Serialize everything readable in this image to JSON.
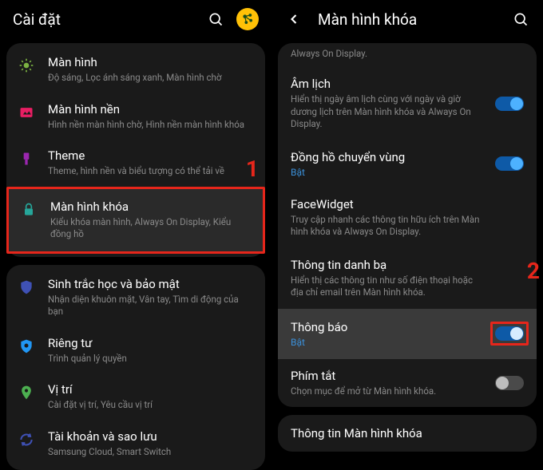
{
  "left": {
    "header_title": "Cài đặt",
    "items": [
      {
        "title": "Màn hình",
        "sub": "Độ sáng, Lọc ánh sáng xanh, Màn hình chờ"
      },
      {
        "title": "Màn hình nền",
        "sub": "Hình nền màn hình chờ, Hình nền màn hình khóa"
      },
      {
        "title": "Theme",
        "sub": "Theme, hình nền và biểu tượng có thể tải về"
      },
      {
        "title": "Màn hình khóa",
        "sub": "Kiểu khóa màn hình, Always On Display, Kiểu đồng hồ"
      },
      {
        "title": "Sinh trắc học và bảo mật",
        "sub": "Nhận diện khuôn mặt, Vân tay, Tìm di động của bạn"
      },
      {
        "title": "Riêng tư",
        "sub": "Trình quản lý quyền"
      },
      {
        "title": "Vị trí",
        "sub": "Cài đặt vị trí, Yêu cầu vị trí"
      },
      {
        "title": "Tài khoản và sao lưu",
        "sub": "Samsung Cloud, Smart Switch"
      }
    ],
    "badge1": "1"
  },
  "right": {
    "header_title": "Màn hình khóa",
    "truncated": "Always On Display.",
    "rows": {
      "amlich": {
        "title": "Âm lịch",
        "sub": "Hiển thị ngày âm lịch cùng với ngày và giờ dương lịch trên Màn hình khóa và Always On Display."
      },
      "dongho": {
        "title": "Đồng hồ chuyển vùng",
        "status": "Bật"
      },
      "facewidget": {
        "title": "FaceWidget",
        "sub": "Truy cập nhanh các thông tin hữu ích trên Màn hình khóa và Always On Display."
      },
      "danhba": {
        "title": "Thông tin danh bạ",
        "sub": "Hiển thị các thông tin như số điện thoại hoặc địa chỉ email trên Màn hình khóa."
      },
      "thongbao": {
        "title": "Thông báo",
        "status": "Bật"
      },
      "phimtat": {
        "title": "Phím tắt",
        "sub": "Chọn mục để mở từ Màn hình khóa."
      }
    },
    "bottom": "Thông tin Màn hình khóa",
    "badge2": "2"
  }
}
